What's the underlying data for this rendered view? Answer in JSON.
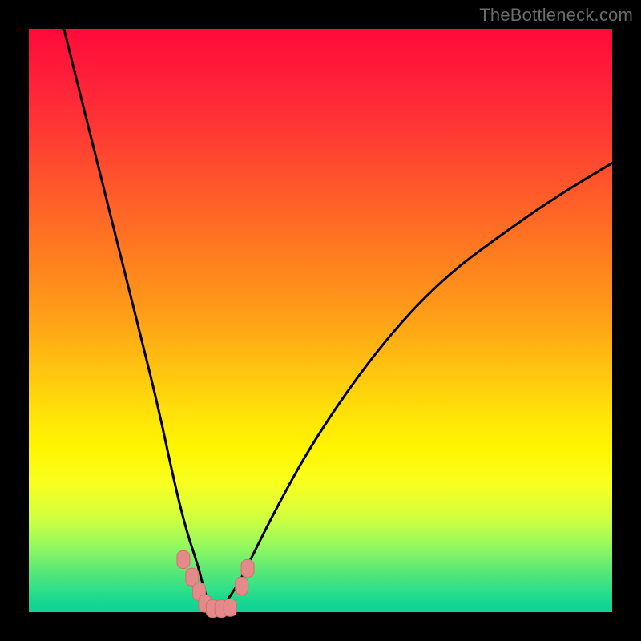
{
  "watermark": "TheBottleneck.com",
  "chart_data": {
    "type": "line",
    "title": "",
    "xlabel": "",
    "ylabel": "",
    "xlim": [
      0,
      100
    ],
    "ylim": [
      0,
      100
    ],
    "grid": false,
    "legend": false,
    "series": [
      {
        "name": "bottleneck-curve",
        "x": [
          6,
          10,
          14,
          18,
          22,
          25,
          27,
          29,
          30,
          31,
          32,
          33,
          34,
          36,
          38,
          42,
          48,
          56,
          64,
          72,
          80,
          90,
          100
        ],
        "y": [
          100,
          84,
          68,
          52,
          36,
          22,
          14,
          8,
          4,
          1,
          0,
          0.5,
          2,
          5,
          9,
          17,
          28,
          40,
          50,
          58,
          64,
          71,
          77
        ]
      }
    ],
    "markers": [
      {
        "name": "marker",
        "x": 26.5,
        "y": 9,
        "label": ""
      },
      {
        "name": "marker",
        "x": 28.0,
        "y": 6,
        "label": ""
      },
      {
        "name": "marker",
        "x": 29.2,
        "y": 3.5,
        "label": ""
      },
      {
        "name": "marker",
        "x": 30.2,
        "y": 1.5,
        "label": ""
      },
      {
        "name": "marker",
        "x": 31.5,
        "y": 0.6,
        "label": ""
      },
      {
        "name": "marker",
        "x": 33.0,
        "y": 0.6,
        "label": ""
      },
      {
        "name": "marker",
        "x": 34.5,
        "y": 0.8,
        "label": ""
      },
      {
        "name": "marker",
        "x": 36.5,
        "y": 4.5,
        "label": ""
      },
      {
        "name": "marker",
        "x": 37.5,
        "y": 7.5,
        "label": ""
      }
    ],
    "colors": {
      "curve": "#000000",
      "marker_fill": "#e58a8a",
      "marker_stroke": "#d46f6f"
    }
  }
}
